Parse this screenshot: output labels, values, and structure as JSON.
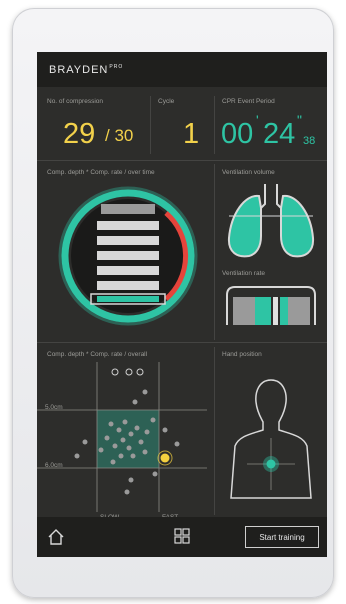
{
  "brand": {
    "name": "BRAYDEN",
    "suffix": "PRO"
  },
  "metrics": {
    "compressions_label": "No. of compression",
    "compressions_value": "29",
    "compressions_total": "/ 30",
    "cycle_label": "Cycle",
    "cycle_value": "1",
    "cpr_label": "CPR Event Period",
    "cpr_min": "00",
    "cpr_sec": "24",
    "cpr_frac": "38"
  },
  "panels": {
    "depth_rate_time": "Comp. depth * Comp. rate / over time",
    "ventilation_volume": "Ventilation volume",
    "ventilation_rate": "Ventilation rate",
    "depth_rate_overall": "Comp. depth * Comp. rate / overall",
    "hand_position": "Hand position"
  },
  "scatter": {
    "label_50": "5.0cm",
    "label_60": "6.0cm",
    "slow": "SLOW",
    "fast": "FAST"
  },
  "bottom": {
    "start_label": "Start training"
  },
  "colors": {
    "accent": "#2ec4a4",
    "warning": "#e5443b",
    "highlight": "#f4d03f",
    "bg": "#2d2d2b"
  },
  "icons": [
    "home-icon",
    "grid-icon"
  ]
}
